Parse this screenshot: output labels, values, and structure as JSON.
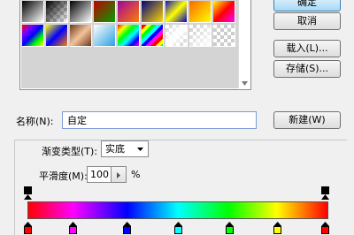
{
  "preset_swatches": [
    "linear-gradient(135deg,#000,#fff)",
    "linear-gradient(135deg,#000,rgba(0,0,0,0)),repeating-conic-gradient(#ccc 0 25%,#fff 0 50%) 0 0/8px 8px",
    "linear-gradient(135deg,#000,#fff)",
    "linear-gradient(135deg,#c00000,#00a000)",
    "linear-gradient(135deg,#a000a0,#ff8000)",
    "linear-gradient(135deg,#000080,#ffd700)",
    "linear-gradient(135deg,#1010c0,#ffff00,#0000c0)",
    "linear-gradient(135deg,#ff6600,#ffff00)",
    "linear-gradient(135deg,#ffff00,#ff0000,#ff00ff)",
    "linear-gradient(135deg,#ff0000,#8000ff,#0000ff,#00ff00,#ffff00)",
    "linear-gradient(135deg,#ffff00,#0000ff,#ff8000)",
    "linear-gradient(135deg,#6b3a1f,#f5c39a,#6b3a1f)",
    "linear-gradient(135deg,#ffffff,#2aa0e0)",
    "linear-gradient(135deg,#ff0000,#ffff00,#00ff00,#00ffff,#0000ff,#ff00ff)",
    "repeating-linear-gradient(135deg,#ff0000 0 4px,#ffff00 4px 8px,#00ff00 8px 12px,#00ffff 12px 16px,#0000ff 16px 20px,#ff00ff 20px 24px)",
    "linear-gradient(135deg,rgba(255,255,255,0),#fff 50%,rgba(255,255,255,0)),repeating-conic-gradient(#ccc 0 25%,#fff 0 50%) 0 0/8px 8px",
    "linear-gradient(135deg,rgba(0,0,0,0),#fff),repeating-conic-gradient(#ccc 0 25%,#fff 0 50%) 0 0/8px 8px",
    "repeating-conic-gradient(#ccc 0 25%,#fff 0 50%) 0 0/8px 8px"
  ],
  "buttons": {
    "ok": "确定",
    "cancel": "取消",
    "load": "载入(L)...",
    "save": "存储(S)...",
    "new": "新建(W)"
  },
  "name_label": "名称(N):",
  "name_value": "自定",
  "gradient_type_label": "渐变类型(T):",
  "gradient_type_value": "实底",
  "smoothness_label": "平滑度(M):",
  "smoothness_value": "100",
  "smoothness_unit": "%",
  "colors": {
    "gradient": [
      "#ff0000",
      "#ff00ff",
      "#0000ff",
      "#00ffff",
      "#00ff00",
      "#ffff00",
      "#ff0000"
    ]
  },
  "color_stops": [
    {
      "color": "#ff0000",
      "location_percent": 0
    },
    {
      "color": "#ff00ff",
      "location_percent": 15
    },
    {
      "color": "#0000ff",
      "location_percent": 33
    },
    {
      "color": "#00ffff",
      "location_percent": 50
    },
    {
      "color": "#00ff00",
      "location_percent": 67
    },
    {
      "color": "#ffff00",
      "location_percent": 83
    },
    {
      "color": "#ff0000",
      "location_percent": 100
    }
  ],
  "opacity_stops": [
    {
      "location_percent": 0
    },
    {
      "location_percent": 100
    }
  ]
}
